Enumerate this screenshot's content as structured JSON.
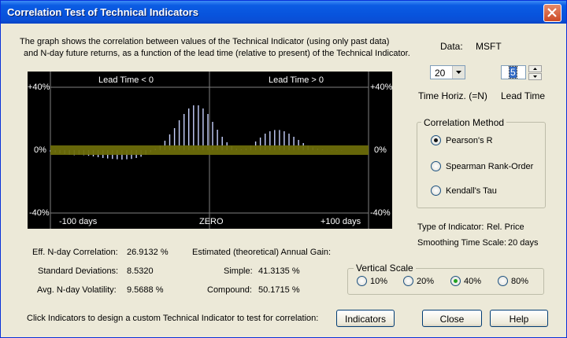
{
  "window": {
    "title": "Correlation Test of Technical Indicators"
  },
  "description": {
    "line1": "The graph shows the correlation between values of the Technical Indicator (using only past data)",
    "line2": "and N-day future returns, as a function of the lead time (relative to present) of the Technical Indicator."
  },
  "data_label": "Data:",
  "data_value": "MSFT",
  "time_horiz": {
    "value": "20",
    "label": "Time Horiz. (=N)"
  },
  "lead_time": {
    "value": "5",
    "label": "Lead Time"
  },
  "graph": {
    "lead_neg": "Lead Time < 0",
    "lead_pos": "Lead Time > 0",
    "y_top_left": "+40%",
    "y_mid_left": "0%",
    "y_bot_left": "-40%",
    "y_top_right": "+40%",
    "y_mid_right": "0%",
    "y_bot_right": "-40%",
    "x_left": "-100 days",
    "x_mid": "ZERO",
    "x_right": "+100 days"
  },
  "chart_data": {
    "type": "bar",
    "x_range": [
      -100,
      100
    ],
    "ylim": [
      -40,
      40
    ],
    "band_pct": 3,
    "colors": {
      "bars": "#c8d2ff",
      "band": "#6b6b0a",
      "zero_line": "#808080"
    },
    "x": [
      -100,
      -97,
      -94,
      -91,
      -88,
      -85,
      -82,
      -79,
      -76,
      -73,
      -70,
      -67,
      -64,
      -61,
      -58,
      -55,
      -52,
      -49,
      -46,
      -43,
      -40,
      -37,
      -34,
      -31,
      -28,
      -25,
      -22,
      -19,
      -16,
      -13,
      -10,
      -7,
      -4,
      -1,
      2,
      5,
      8,
      11,
      14,
      17,
      20,
      23,
      26,
      29,
      32,
      35,
      38,
      41,
      44,
      47,
      50,
      53,
      56,
      59,
      62,
      65,
      68,
      71,
      74,
      77,
      80,
      83
    ],
    "values": [
      -1,
      -1.5,
      -2,
      -2.5,
      -3,
      -3.2,
      -3,
      -3.2,
      -3.6,
      -4,
      -4.5,
      -5,
      -5.3,
      -5.6,
      -5.8,
      -6,
      -5.8,
      -5.6,
      -5,
      -4.2,
      -3,
      -1.2,
      0.8,
      3,
      6,
      10,
      14,
      19,
      23,
      26.5,
      28.5,
      28.5,
      26.5,
      23,
      18,
      13,
      8.5,
      5,
      2.5,
      1,
      0.5,
      1,
      3,
      5.5,
      8,
      10.5,
      12,
      12.8,
      12.8,
      12,
      10.5,
      8.5,
      6.5,
      4.5,
      3,
      1.8,
      1,
      0.5,
      0.2,
      0,
      0,
      0
    ]
  },
  "stats": {
    "eff_label": "Eff. N-day Correlation:",
    "eff_value": "26.9132 %",
    "std_label": "Standard Deviations:",
    "std_value": "8.5320",
    "vol_label": "Avg. N-day Volatility:",
    "vol_value": "9.5688 %",
    "gain_label": "Estimated (theoretical) Annual Gain:",
    "simple_label": "Simple:",
    "simple_value": "41.3135 %",
    "compound_label": "Compound:",
    "compound_value": "50.1715 %"
  },
  "correlation_method": {
    "legend": "Correlation Method",
    "options": [
      "Pearson's R",
      "Spearman Rank-Order",
      "Kendall's Tau"
    ],
    "selected": "Pearson's R"
  },
  "indicator": {
    "type_label": "Type of Indicator:",
    "type_value": "Rel. Price",
    "smoothing_label": "Smoothing Time Scale:",
    "smoothing_value": "20 days"
  },
  "vertical_scale": {
    "legend": "Vertical Scale",
    "options": [
      "10%",
      "20%",
      "40%",
      "80%"
    ],
    "selected": "40%"
  },
  "footer_text": "Click Indicators to design a custom Technical Indicator to test for correlation:",
  "buttons": {
    "indicators": "Indicators",
    "close": "Close",
    "help": "Help"
  }
}
